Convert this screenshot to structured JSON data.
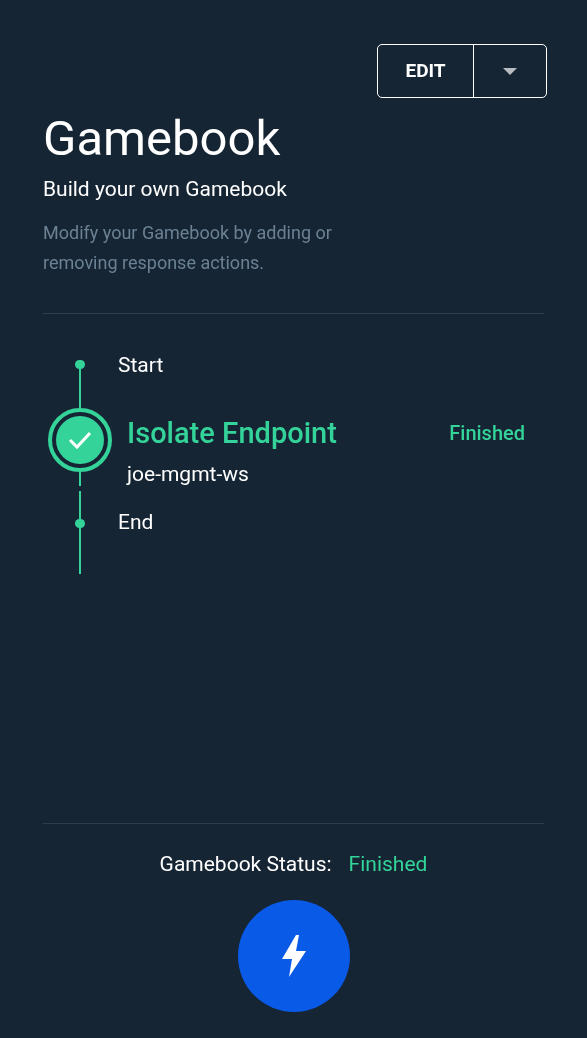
{
  "edit_button": {
    "label": "EDIT"
  },
  "title": "Gamebook",
  "subtitle": "Build your own Gamebook",
  "description": "Modify your Gamebook by adding or removing response actions.",
  "timeline": [
    {
      "kind": "endpoint",
      "label": "Start"
    },
    {
      "kind": "action",
      "label": "Isolate Endpoint",
      "target": "joe-mgmt-ws",
      "status": "Finished",
      "finished": true
    },
    {
      "kind": "endpoint",
      "label": "End"
    }
  ],
  "status_bar": {
    "label": "Gamebook Status:",
    "value": "Finished",
    "finished": true
  }
}
